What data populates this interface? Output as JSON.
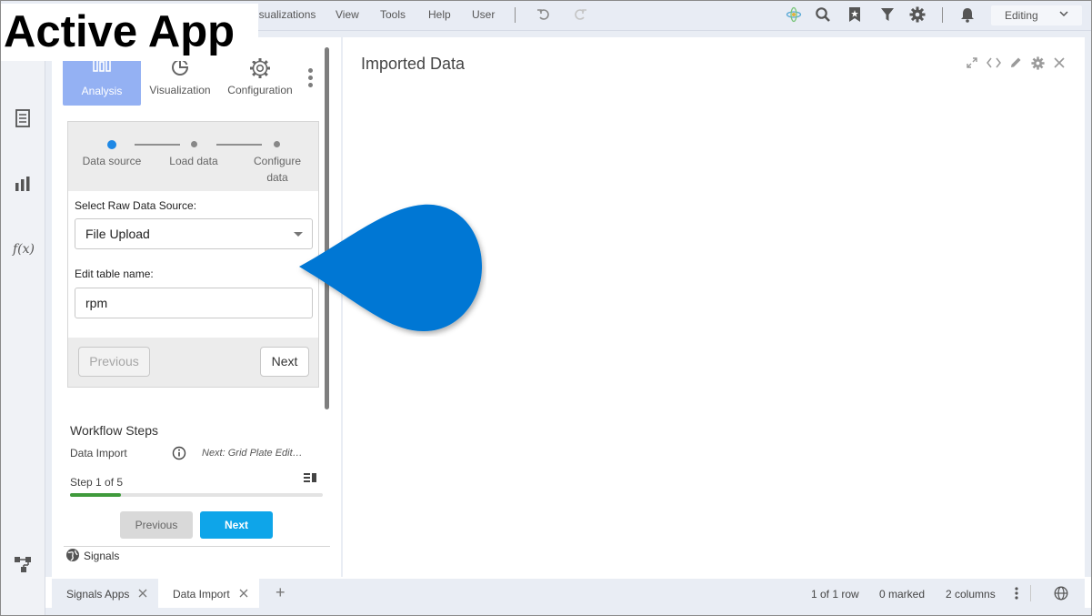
{
  "overlay": {
    "title": "Active App"
  },
  "menubar": {
    "items": [
      "isualizations",
      "View",
      "Tools",
      "Help",
      "User"
    ],
    "mode": "Editing"
  },
  "icons": {
    "undo": "undo-icon",
    "redo": "redo-icon",
    "status": "atom-icon",
    "search": "search-icon",
    "bookmark": "bookmark-icon",
    "filter": "filter-icon",
    "settings": "gear-icon",
    "notifications": "bell-icon"
  },
  "sidebar": {
    "items": [
      {
        "icon": "document-icon"
      },
      {
        "icon": "bar-chart-icon"
      },
      {
        "icon": "function-icon",
        "text": "f(x)"
      },
      {
        "icon": "flow-icon"
      }
    ]
  },
  "panel": {
    "tabs": [
      {
        "label": "Analysis",
        "active": true
      },
      {
        "label": "Visualization",
        "active": false
      },
      {
        "label": "Configuration",
        "active": false
      }
    ],
    "wizard": {
      "steps": [
        {
          "label": "Data source",
          "active": true
        },
        {
          "label": "Load data",
          "active": false
        },
        {
          "label": "Configure data",
          "active": false
        }
      ],
      "source_label": "Select Raw Data Source:",
      "source_value": "File Upload",
      "table_label": "Edit table name:",
      "table_value": "rpm",
      "previous": "Previous",
      "next": "Next"
    },
    "workflow": {
      "title": "Workflow Steps",
      "current": "Data Import",
      "next_step": "Next: Grid Plate Edit…",
      "step_text": "Step 1 of 5",
      "progress": 0.2,
      "previous": "Previous",
      "next": "Next"
    },
    "signals": "Signals"
  },
  "content": {
    "title": "Imported Data"
  },
  "bottom": {
    "tabs": [
      {
        "label": "Signals Apps",
        "active": false
      },
      {
        "label": "Data Import",
        "active": true
      }
    ],
    "add": "+",
    "rows": "1 of 1 row",
    "marked": "0 marked",
    "columns": "2 columns"
  },
  "colors": {
    "accent": "#94b1f3",
    "primary_button": "#0ea5e9",
    "step_active": "#1e88e5",
    "progress": "#3f9a3b",
    "callout": "#0077d4"
  }
}
